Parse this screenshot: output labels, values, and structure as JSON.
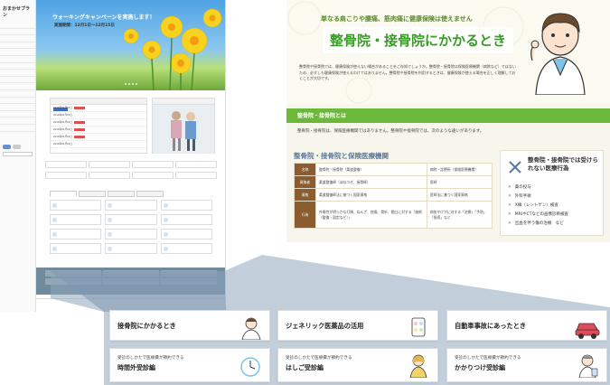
{
  "site": {
    "logo": "おまかせプラン",
    "nav_items": [
      "",
      "",
      "",
      "",
      "",
      "",
      "",
      "",
      "",
      "",
      "",
      "",
      "",
      "",
      "",
      ""
    ],
    "hero_title": "ウォーキングキャンペーンを実施します！",
    "hero_sub": "実施期間：12月1日～12月15日",
    "tabs": [
      "",
      "",
      "",
      ""
    ]
  },
  "article": {
    "lead": "単なる肩こりや腰痛、筋肉痛に健康保険は使えません",
    "title": "整骨院・接骨院にかかるとき",
    "intro": "整骨院や接骨院では、健康保険が使えない場合があることをご存知でしょうか。整骨院・接骨院は保険医療機関（病院など）ではないため、必ずしも健康保険が使えるわけではありません。整骨院や接骨院を利用するときは、健康保険が使える場合を正しく理解しておくことが大切です。",
    "section_label": "整骨院・接骨院とは",
    "section_text": "整骨院・接骨院は、保険医療機関ではありません。整骨院や接骨院では、次のような違いがあります。",
    "table_title": "整骨院・接骨院と保険医療機関",
    "table": {
      "rows": [
        {
          "head": "名称",
          "a": "整骨院・接骨院（柔道整復）",
          "b": "病院・診療所（保険医療機関）"
        },
        {
          "head": "資格者",
          "a": "柔道整復師（ほねつぎ、接骨師）",
          "b": "医師"
        },
        {
          "head": "資格",
          "a": "柔道整復師法に基づく国家資格",
          "b": "医師法に基づく国家資格"
        },
        {
          "head": "行為",
          "a": "外傷性が明らかな打撲、ねんざ、挫傷、骨折、脱臼に対する「施術（整復・固定など）」",
          "b": "病気やけがに対する「治療」「予防」「指導」など"
        }
      ]
    },
    "box_title": "整骨院・接骨院では受けられない医療行為",
    "box_items": [
      "薬の投与",
      "外科手術",
      "X線（レントゲン）検査",
      "MRIやCTなどの画像診断検査",
      "出血を伴う傷の治療　など"
    ]
  },
  "cards": {
    "c1": "接骨院にかかるとき",
    "c2": "ジェネリック医薬品の活用",
    "c3": "自動車事故にあったとき",
    "c4_small": "受診のしかたで医療費が節約できる",
    "c4_big": "時間外受診編",
    "c5_small": "受診のしかたで医療費が節約できる",
    "c5_big": "はしご受診編",
    "c6_small": "受診のしかたで医療費が節約できる",
    "c6_big": "かかりつけ受診編"
  },
  "colors": {
    "green": "#6cb83a",
    "title_green": "#3a9a2a",
    "brown": "#8a5c30",
    "connector": "#7f98b0"
  }
}
